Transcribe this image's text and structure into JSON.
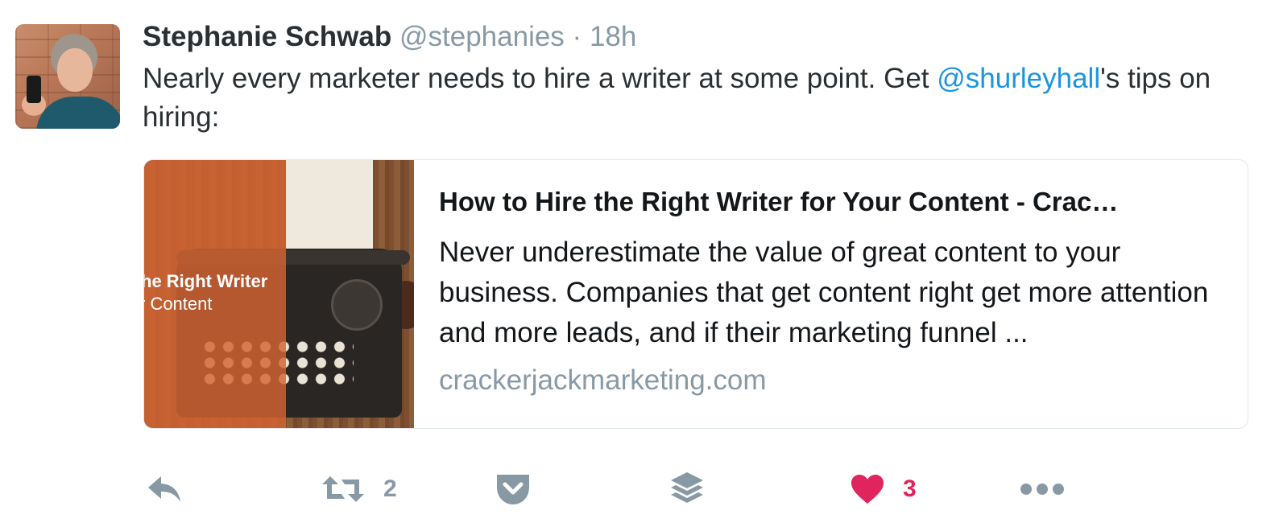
{
  "tweet": {
    "author_name": "Stephanie Schwab",
    "author_handle": "@stephanies",
    "separator": "·",
    "timestamp": "18h",
    "text_before": "Nearly every marketer needs to hire a writer at some point. Get ",
    "mention": "@shurleyhall",
    "text_after": "'s tips on hiring:"
  },
  "card": {
    "image_text_line1": "he Right Writer",
    "image_text_line2": "r Content",
    "title": "How to Hire the Right Writer for Your Content - Crac…",
    "description": "Never underestimate the value of great content to your business. Companies that get content right get more attention and more leads, and if their marketing funnel ...",
    "domain": "crackerjackmarketing.com"
  },
  "actions": {
    "reply_icon": "reply-icon",
    "retweet_icon": "retweet-icon",
    "retweet_count": "2",
    "pocket_icon": "pocket-icon",
    "buffer_icon": "buffer-icon",
    "like_icon": "heart-icon",
    "like_count": "3",
    "more_icon": "more-icon"
  },
  "colors": {
    "mention": "#1b95e0",
    "muted": "#8899a6",
    "like": "#e0245e",
    "name": "#292f33"
  }
}
